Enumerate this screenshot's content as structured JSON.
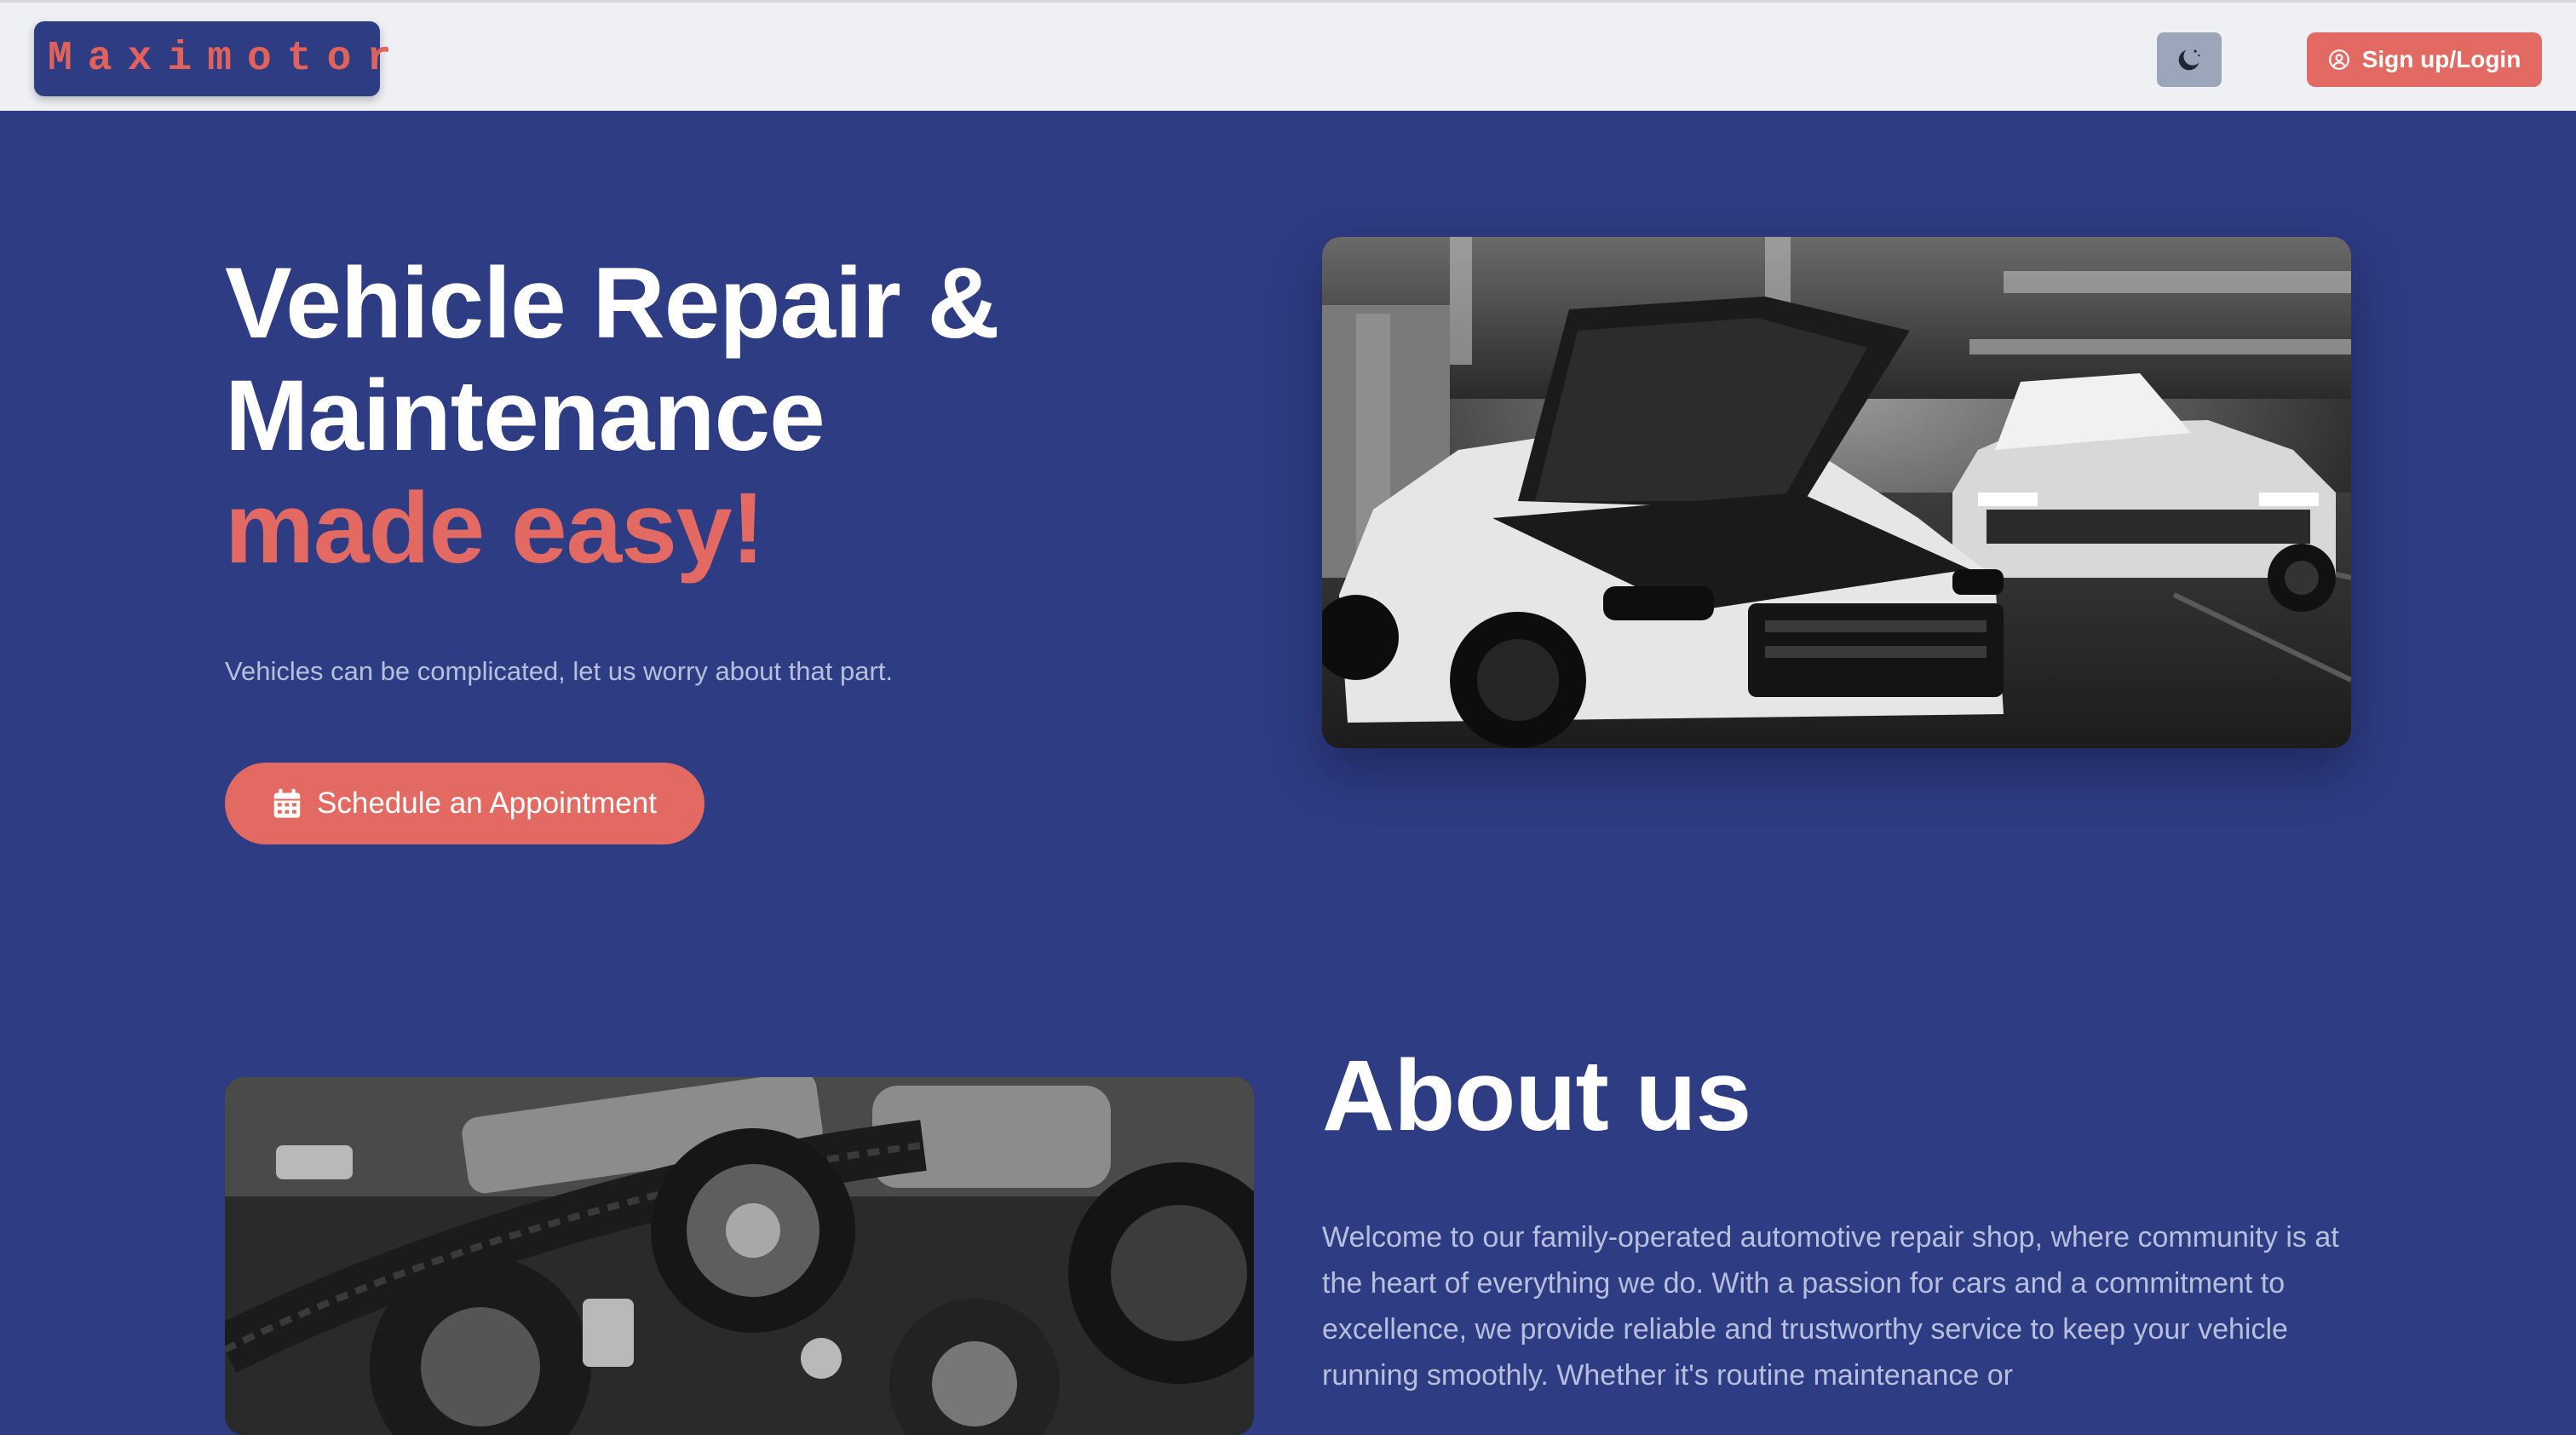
{
  "brand": {
    "name": "Maximotor"
  },
  "navbar": {
    "theme_toggle_icon": "moon-icon",
    "login_icon": "user-circle-icon",
    "login_label": "Sign up/Login"
  },
  "hero": {
    "title_line1": "Vehicle Repair &",
    "title_line2": "Maintenance",
    "title_accent": "made easy!",
    "subtitle": "Vehicles can be complicated, let us worry about that part.",
    "cta_icon": "calendar-icon",
    "cta_label": "Schedule an Appointment"
  },
  "about": {
    "title": "About us",
    "text": "Welcome to our family-operated automotive repair shop, where community is at the heart of everything we do. With a passion for cars and a commitment to excellence, we provide reliable and trustworthy service to keep your vehicle running smoothly. Whether it's routine maintenance or"
  },
  "colors": {
    "page_background": "#2e3c83",
    "navbar_background": "#eef0f4",
    "accent": "#e36a62",
    "muted_text": "#b8bfdc",
    "toggle_background": "#9ba6ba"
  }
}
